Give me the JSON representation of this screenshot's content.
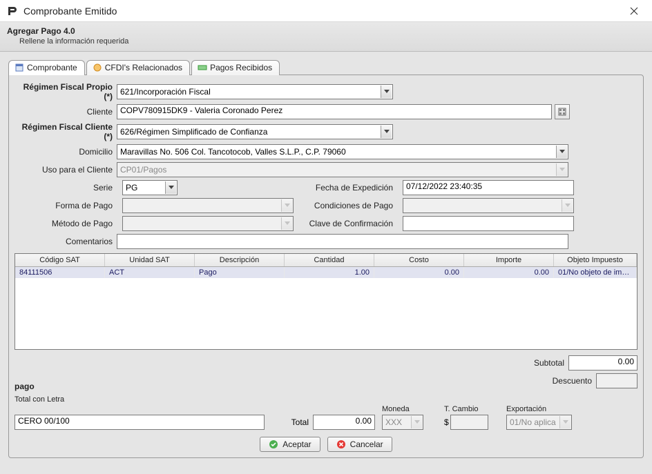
{
  "window": {
    "title": "Comprobante Emitido"
  },
  "header": {
    "title": "Agregar Pago 4.0",
    "subtitle": "Rellene la información requerida"
  },
  "tabs": {
    "comprobante": "Comprobante",
    "cfdi": "CFDI's Relacionados",
    "pagos": "Pagos Recibidos"
  },
  "labels": {
    "regimen_propio": "Régimen Fiscal Propio (*)",
    "cliente": "Cliente",
    "regimen_cliente": "Régimen Fiscal Cliente (*)",
    "domicilio": "Domicilio",
    "uso": "Uso para el Cliente",
    "serie": "Serie",
    "fecha": "Fecha de Expedición",
    "forma_pago": "Forma de Pago",
    "condiciones": "Condiciones de Pago",
    "metodo_pago": "Método de Pago",
    "clave_conf": "Clave de Confirmación",
    "comentarios": "Comentarios",
    "subtotal": "Subtotal",
    "descuento": "Descuento",
    "total_letra": "Total con Letra",
    "total": "Total",
    "moneda": "Moneda",
    "tcambio": "T. Cambio",
    "exportacion": "Exportación",
    "pago_word": "pago"
  },
  "form": {
    "regimen_propio": "621/Incorporación Fiscal",
    "cliente": "COPV780915DK9 - Valeria Coronado Perez",
    "regimen_cliente": "626/Régimen Simplificado de Confianza",
    "domicilio": "Maravillas No. 506 Col. Tancotocob, Valles S.L.P., C.P. 79060",
    "uso": "CP01/Pagos",
    "serie": "PG",
    "fecha": "07/12/2022 23:40:35",
    "forma_pago": "",
    "condiciones": "",
    "metodo_pago": "",
    "clave_conf": "",
    "comentarios": "",
    "subtotal": "0.00",
    "descuento": "",
    "total": "0.00",
    "total_letra": "CERO  00/100",
    "moneda": "XXX",
    "tcambio_prefix": "$",
    "tcambio": "",
    "exportacion": "01/No aplica"
  },
  "table": {
    "headers": {
      "codigo": "Código SAT",
      "unidad": "Unidad SAT",
      "descripcion": "Descripción",
      "cantidad": "Cantidad",
      "costo": "Costo",
      "importe": "Importe",
      "objeto": "Objeto Impuesto"
    },
    "rows": [
      {
        "codigo": "84111506",
        "unidad": "ACT",
        "descripcion": "Pago",
        "cantidad": "1.00",
        "costo": "0.00",
        "importe": "0.00",
        "objeto": "01/No objeto de imp..."
      }
    ]
  },
  "actions": {
    "accept": "Aceptar",
    "cancel": "Cancelar"
  }
}
